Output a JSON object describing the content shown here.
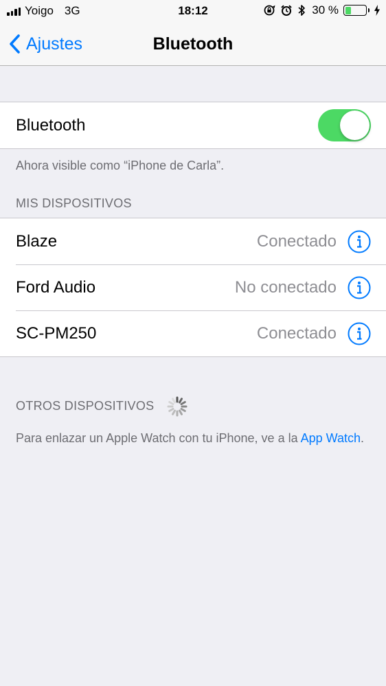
{
  "status_bar": {
    "carrier": "Yoigo",
    "network": "3G",
    "time": "18:12",
    "battery_percent": "30 %",
    "battery_level": 0.3,
    "icons": [
      "signal-icon",
      "orientation-lock-icon",
      "alarm-icon",
      "bluetooth-icon",
      "battery-icon",
      "charging-icon"
    ]
  },
  "nav": {
    "back_label": "Ajustes",
    "title": "Bluetooth"
  },
  "bluetooth_toggle": {
    "label": "Bluetooth",
    "on": true
  },
  "visibility_note": "Ahora visible como “iPhone de Carla”.",
  "my_devices": {
    "header": "MIS DISPOSITIVOS",
    "items": [
      {
        "name": "Blaze",
        "status": "Conectado"
      },
      {
        "name": "Ford Audio",
        "status": "No conectado"
      },
      {
        "name": "SC-PM250",
        "status": "Conectado"
      }
    ]
  },
  "other_devices": {
    "header": "OTROS DISPOSITIVOS",
    "note_text": "Para enlazar un Apple Watch con tu iPhone, ve a la ",
    "note_link": "App Watch",
    "note_end": "."
  },
  "colors": {
    "accent": "#007aff",
    "toggle_on": "#4cd964",
    "background": "#efeff4",
    "secondary_text": "#8e8e93"
  }
}
